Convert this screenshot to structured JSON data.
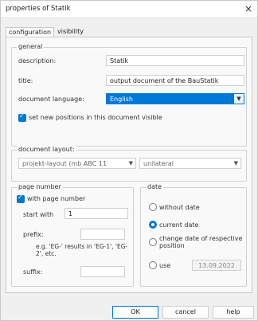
{
  "window": {
    "title": "properties of Statik",
    "close_symbol": "×"
  },
  "tabs": [
    {
      "label": "configuration",
      "active": true
    },
    {
      "label": "visibility",
      "active": false
    }
  ],
  "general": {
    "legend": "general",
    "description_label": "description:",
    "description_value": "Statik",
    "title_label": "title:",
    "title_value": "output document of the BauStatik",
    "language_label": "document language:",
    "language_value": "English",
    "set_visible_label": "set new positions in this document visible",
    "set_visible_checked": true
  },
  "layout": {
    "label": "document layout:",
    "layout_value": "projekt-layout (mb ABC 11",
    "sides_value": "unilateral"
  },
  "page_number": {
    "legend": "page number",
    "with_page_number_label": "with page number",
    "with_page_number_checked": true,
    "start_with_label": "start with",
    "start_with_value": "1",
    "prefix_label": "prefix:",
    "prefix_value": "",
    "prefix_hint": "e.g. 'EG-' results in 'EG-1', 'EG-2', etc.",
    "suffix_label": "suffix:",
    "suffix_value": ""
  },
  "date": {
    "legend": "date",
    "options": [
      {
        "label": "without date",
        "selected": false
      },
      {
        "label": "current date",
        "selected": true
      },
      {
        "label": "change date of respective position",
        "selected": false
      },
      {
        "label": "use",
        "selected": false
      }
    ],
    "use_value": "13.09.2022"
  },
  "buttons": {
    "ok": "OK",
    "cancel": "cancel",
    "help": "help"
  },
  "colors": {
    "accent": "#0078d7"
  }
}
